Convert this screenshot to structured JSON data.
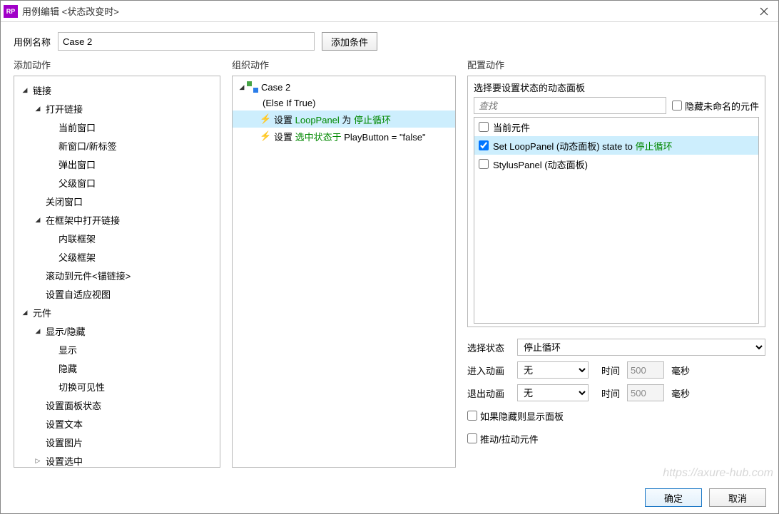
{
  "window": {
    "title": "用例编辑 <状态改变时>"
  },
  "nameRow": {
    "label": "用例名称",
    "value": "Case 2",
    "addCondition": "添加条件"
  },
  "columns": {
    "addAction": "添加动作",
    "organize": "组织动作",
    "configure": "配置动作"
  },
  "tree": [
    {
      "depth": 0,
      "tw": "open",
      "label": "链接"
    },
    {
      "depth": 1,
      "tw": "open",
      "label": "打开链接"
    },
    {
      "depth": 2,
      "tw": "",
      "label": "当前窗口"
    },
    {
      "depth": 2,
      "tw": "",
      "label": "新窗口/新标签"
    },
    {
      "depth": 2,
      "tw": "",
      "label": "弹出窗口"
    },
    {
      "depth": 2,
      "tw": "",
      "label": "父级窗口"
    },
    {
      "depth": 1,
      "tw": "",
      "label": "关闭窗口"
    },
    {
      "depth": 1,
      "tw": "open",
      "label": "在框架中打开链接"
    },
    {
      "depth": 2,
      "tw": "",
      "label": "内联框架"
    },
    {
      "depth": 2,
      "tw": "",
      "label": "父级框架"
    },
    {
      "depth": 1,
      "tw": "",
      "label": "滚动到元件<锚链接>"
    },
    {
      "depth": 1,
      "tw": "",
      "label": "设置自适应视图"
    },
    {
      "depth": 0,
      "tw": "open",
      "label": "元件"
    },
    {
      "depth": 1,
      "tw": "open",
      "label": "显示/隐藏"
    },
    {
      "depth": 2,
      "tw": "",
      "label": "显示"
    },
    {
      "depth": 2,
      "tw": "",
      "label": "隐藏"
    },
    {
      "depth": 2,
      "tw": "",
      "label": "切换可见性"
    },
    {
      "depth": 1,
      "tw": "",
      "label": "设置面板状态"
    },
    {
      "depth": 1,
      "tw": "",
      "label": "设置文本"
    },
    {
      "depth": 1,
      "tw": "",
      "label": "设置图片"
    },
    {
      "depth": 1,
      "tw": "closed",
      "label": "设置选中"
    }
  ],
  "caseTree": {
    "caseName": "Case 2",
    "condition": "(Else If True)",
    "actions": [
      {
        "prefix": "设置",
        "greenA": "LoopPanel",
        "mid": " 为 ",
        "greenB": "停止循环",
        "sel": true
      },
      {
        "prefix": "设置",
        "greenA": "选中状态于",
        "mid": " PlayButton = \"false\"",
        "greenB": "",
        "sel": false
      }
    ]
  },
  "configure": {
    "header": "选择要设置状态的动态面板",
    "searchPlaceholder": "查找",
    "hideUnnamed": "隐藏未命名的元件",
    "panels": [
      {
        "label": "当前元件",
        "checked": false,
        "sel": false,
        "green": ""
      },
      {
        "label": "Set LoopPanel (动态面板) state to ",
        "checked": true,
        "sel": true,
        "green": "停止循环"
      },
      {
        "label": "StylusPanel (动态面板)",
        "checked": false,
        "sel": false,
        "green": ""
      }
    ],
    "selectStateLabel": "选择状态",
    "selectStateValue": "停止循环",
    "animInLabel": "进入动画",
    "animOutLabel": "退出动画",
    "animNone": "无",
    "timeLabel": "时间",
    "timeValue": "500",
    "msLabel": "毫秒",
    "cbShow": "如果隐藏则显示面板",
    "cbPush": "推动/拉动元件"
  },
  "footer": {
    "ok": "确定",
    "cancel": "取消"
  },
  "watermark": "https://axure-hub.com"
}
